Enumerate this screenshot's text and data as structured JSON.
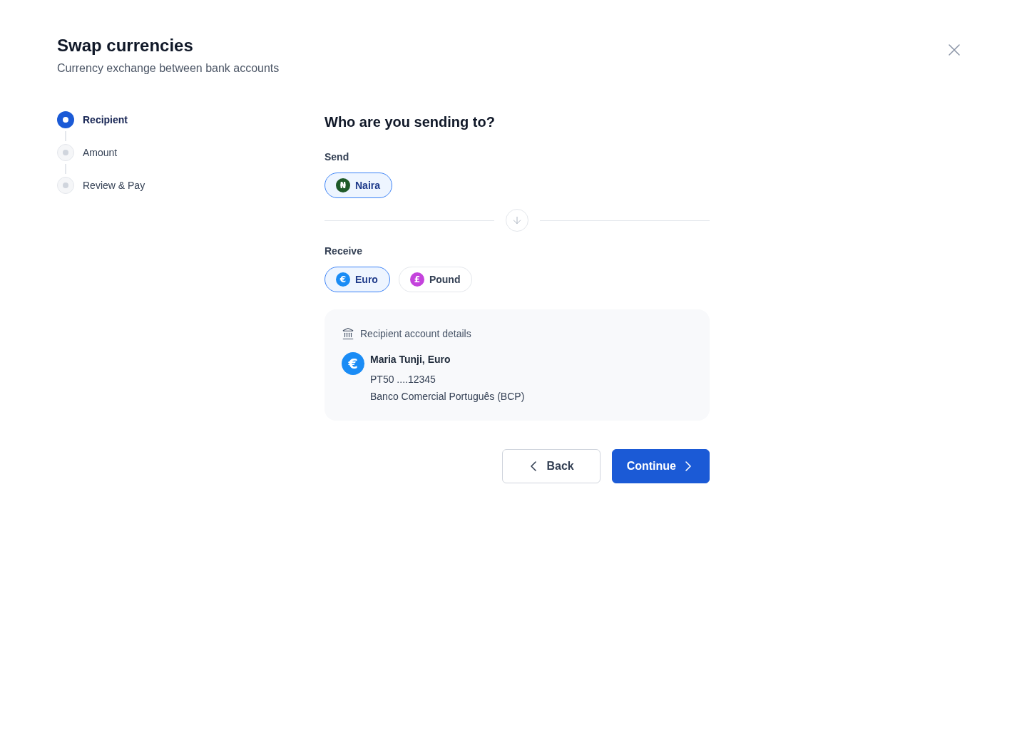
{
  "dialog": {
    "title": "Swap currencies",
    "subtitle": "Currency exchange between bank accounts"
  },
  "steps": [
    {
      "label": "Recipient",
      "selected": true
    },
    {
      "label": "Amount",
      "selected": false
    },
    {
      "label": "Review & Pay",
      "selected": false
    }
  ],
  "form": {
    "heading": "Who are you sending to?",
    "send": {
      "label": "Send",
      "options": [
        {
          "symbol": "₦",
          "name": "Naira",
          "color": "#1f5a28",
          "selected": true
        }
      ]
    },
    "receive": {
      "label": "Receive",
      "options": [
        {
          "symbol": "€",
          "name": "Euro",
          "color": "#1a8cf5",
          "selected": true
        },
        {
          "symbol": "£",
          "name": "Pound",
          "color": "#c443dc",
          "selected": false
        }
      ]
    }
  },
  "recipient_card": {
    "title": "Recipient account details",
    "symbol": "€",
    "name": "Maria Tunji, Euro",
    "account": "PT50 ....12345",
    "bank": "Banco Comercial Português (BCP)"
  },
  "buttons": [
    {
      "kind": "back",
      "label": "Back"
    },
    {
      "kind": "continue",
      "label": "Continue"
    }
  ]
}
